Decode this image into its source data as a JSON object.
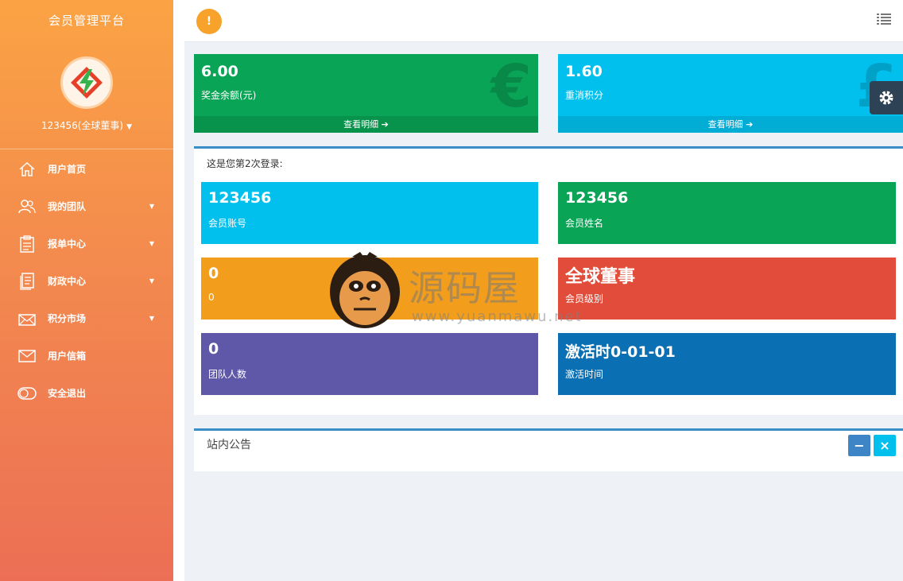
{
  "sidebar": {
    "brand": "会员管理平台",
    "user": "123456(全球董事)",
    "menu": [
      {
        "label": "用户首页",
        "icon": "home-icon",
        "has_caret": false
      },
      {
        "label": "我的团队",
        "icon": "team-icon",
        "has_caret": true
      },
      {
        "label": "报单中心",
        "icon": "clipboard-icon",
        "has_caret": true
      },
      {
        "label": "财政中心",
        "icon": "ledger-icon",
        "has_caret": true
      },
      {
        "label": "积分市场",
        "icon": "mail-open-icon",
        "has_caret": true
      },
      {
        "label": "用户信箱",
        "icon": "envelope-icon",
        "has_caret": false
      },
      {
        "label": "安全退出",
        "icon": "toggle-icon",
        "has_caret": false
      }
    ]
  },
  "topbar": {
    "alert_glyph": "!"
  },
  "stats": [
    {
      "value": "6.00",
      "label": "奖金余额(元)",
      "symbol": "€",
      "link": "查看明细",
      "color": "#0aa456"
    },
    {
      "value": "1.60",
      "label": "重消积分",
      "symbol": "£",
      "link": "查看明细",
      "color": "#02c0ee"
    }
  ],
  "login_panel": {
    "text": "这是您第2次登录:",
    "cards": [
      {
        "value": "123456",
        "label": "会员账号",
        "color": "#02c0ee"
      },
      {
        "value": "123456",
        "label": "会员姓名",
        "color": "#0aa456"
      },
      {
        "value": "0",
        "label": "0",
        "color": "#f29d1b"
      },
      {
        "value": "全球董事",
        "label": "会员级别",
        "color": "#e14d3a"
      },
      {
        "value": "0",
        "label": "团队人数",
        "color": "#5f58a8"
      },
      {
        "value": "激活时0-01-01",
        "label": "激活时间",
        "color": "#0b6fb4"
      }
    ]
  },
  "notice_panel": {
    "title": "站内公告",
    "collapse_glyph": "−",
    "close_glyph": "×"
  },
  "watermark": {
    "text": "源码屋",
    "url": "www.yuanmawu.net"
  }
}
